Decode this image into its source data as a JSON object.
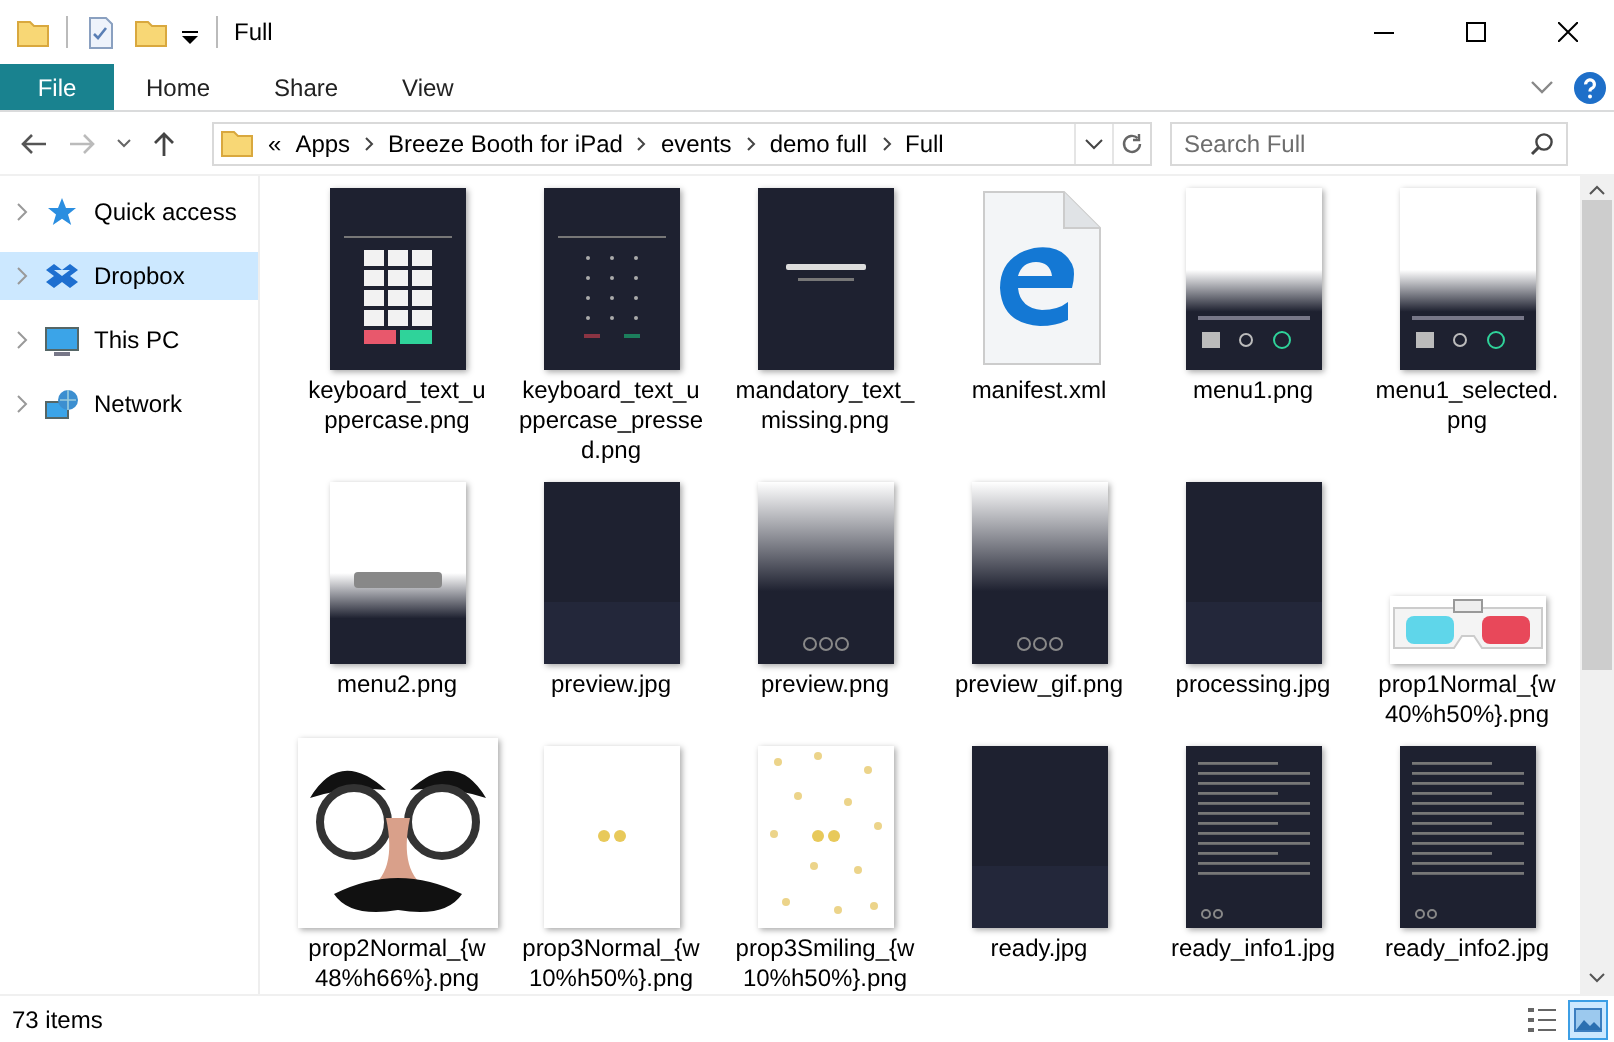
{
  "window": {
    "title": "Full"
  },
  "ribbon": {
    "tabs": [
      {
        "label": "File",
        "kind": "menu"
      },
      {
        "label": "Home",
        "kind": "tab"
      },
      {
        "label": "Share",
        "kind": "tab"
      },
      {
        "label": "View",
        "kind": "tab"
      }
    ]
  },
  "address": {
    "overflow": "«",
    "crumbs": [
      "Apps",
      "Breeze Booth for iPad",
      "events",
      "demo full",
      "Full"
    ]
  },
  "search": {
    "placeholder": "Search Full"
  },
  "sidebar": {
    "items": [
      {
        "label": "Quick access",
        "kind": "star",
        "selected": false
      },
      {
        "label": "Dropbox",
        "kind": "dropbox",
        "selected": true
      },
      {
        "label": "This PC",
        "kind": "pc",
        "selected": false
      },
      {
        "label": "Network",
        "kind": "network",
        "selected": false
      }
    ]
  },
  "files": [
    {
      "name": "keyboard_text_uppercase.png",
      "kind": "keypad"
    },
    {
      "name": "keyboard_text_uppercase_pressed.png",
      "kind": "keypad-dim"
    },
    {
      "name": "mandatory_text_missing.png",
      "kind": "dark-message"
    },
    {
      "name": "manifest.xml",
      "kind": "xml"
    },
    {
      "name": "menu1.png",
      "kind": "menu-fade"
    },
    {
      "name": "menu1_selected.png",
      "kind": "menu-fade"
    },
    {
      "name": "menu2.png",
      "kind": "fade-bar"
    },
    {
      "name": "preview.jpg",
      "kind": "dark"
    },
    {
      "name": "preview.png",
      "kind": "fade-buttons"
    },
    {
      "name": "preview_gif.png",
      "kind": "fade-buttons"
    },
    {
      "name": "processing.jpg",
      "kind": "dark"
    },
    {
      "name": "prop1Normal_{w40%h50%}.png",
      "kind": "glasses-3d"
    },
    {
      "name": "prop2Normal_{w48%h66%}.png",
      "kind": "disguise"
    },
    {
      "name": "prop3Normal_{w10%h50%}.png",
      "kind": "pair-dots"
    },
    {
      "name": "prop3Smiling_{w10%h50%}.png",
      "kind": "confetti"
    },
    {
      "name": "ready.jpg",
      "kind": "dark"
    },
    {
      "name": "ready_info1.jpg",
      "kind": "dark-text"
    },
    {
      "name": "ready_info2.jpg",
      "kind": "dark-text"
    }
  ],
  "status_bar": {
    "count": "73 items",
    "views": [
      {
        "kind": "details",
        "selected": false
      },
      {
        "kind": "large-icons",
        "selected": true
      }
    ]
  }
}
